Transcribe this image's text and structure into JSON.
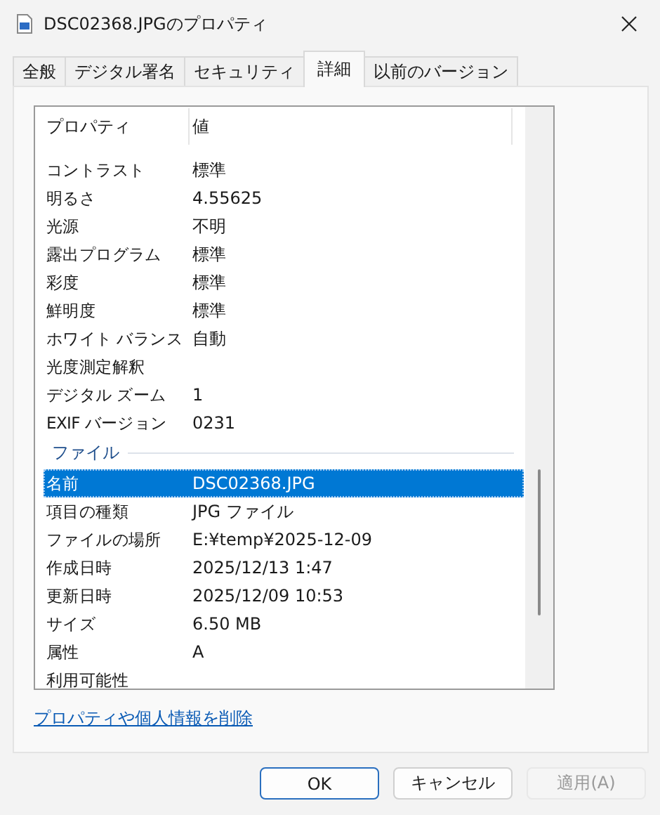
{
  "window": {
    "title": "DSC02368.JPGのプロパティ"
  },
  "tabs": [
    {
      "label": "全般",
      "selected": false
    },
    {
      "label": "デジタル署名",
      "selected": false
    },
    {
      "label": "セキュリティ",
      "selected": false
    },
    {
      "label": "詳細",
      "selected": true
    },
    {
      "label": "以前のバージョン",
      "selected": false
    }
  ],
  "list": {
    "columns": [
      "プロパティ",
      "値"
    ],
    "rows": [
      {
        "kind": "row",
        "name": "コントラスト",
        "value": "標準",
        "selected": false
      },
      {
        "kind": "row",
        "name": "明るさ",
        "value": "4.55625",
        "selected": false
      },
      {
        "kind": "row",
        "name": "光源",
        "value": "不明",
        "selected": false
      },
      {
        "kind": "row",
        "name": "露出プログラム",
        "value": "標準",
        "selected": false
      },
      {
        "kind": "row",
        "name": "彩度",
        "value": "標準",
        "selected": false
      },
      {
        "kind": "row",
        "name": "鮮明度",
        "value": "標準",
        "selected": false
      },
      {
        "kind": "row",
        "name": "ホワイト バランス",
        "value": "自動",
        "selected": false
      },
      {
        "kind": "row",
        "name": "光度測定解釈",
        "selected": false
      },
      {
        "kind": "row",
        "name": "デジタル ズーム",
        "value": "1",
        "selected": false
      },
      {
        "kind": "row",
        "name": "EXIF バージョン",
        "value": "0231",
        "selected": false
      },
      {
        "kind": "group",
        "name": "ファイル"
      },
      {
        "kind": "row",
        "name": "名前",
        "value": "DSC02368.JPG",
        "selected": true
      },
      {
        "kind": "row",
        "name": "項目の種類",
        "value": "JPG ファイル",
        "selected": false
      },
      {
        "kind": "row",
        "name": "ファイルの場所",
        "value": "E:¥temp¥2025-12-09",
        "selected": false
      },
      {
        "kind": "row",
        "name": "作成日時",
        "value": "2025/12/13 1:47",
        "selected": false
      },
      {
        "kind": "row",
        "name": "更新日時",
        "value": "2025/12/09 10:53",
        "selected": false
      },
      {
        "kind": "row",
        "name": "サイズ",
        "value": "6.50 MB",
        "selected": false
      },
      {
        "kind": "row",
        "name": "属性",
        "value": "A",
        "selected": false
      },
      {
        "kind": "row",
        "name": "利用可能性",
        "selected": false
      }
    ]
  },
  "link": "プロパティや個人情報を削除",
  "buttons": [
    {
      "label": "OK",
      "default": true,
      "disabled": false
    },
    {
      "label": "キャンセル",
      "default": false,
      "disabled": false
    },
    {
      "label": "適用(A)",
      "default": false,
      "disabled": true
    }
  ]
}
